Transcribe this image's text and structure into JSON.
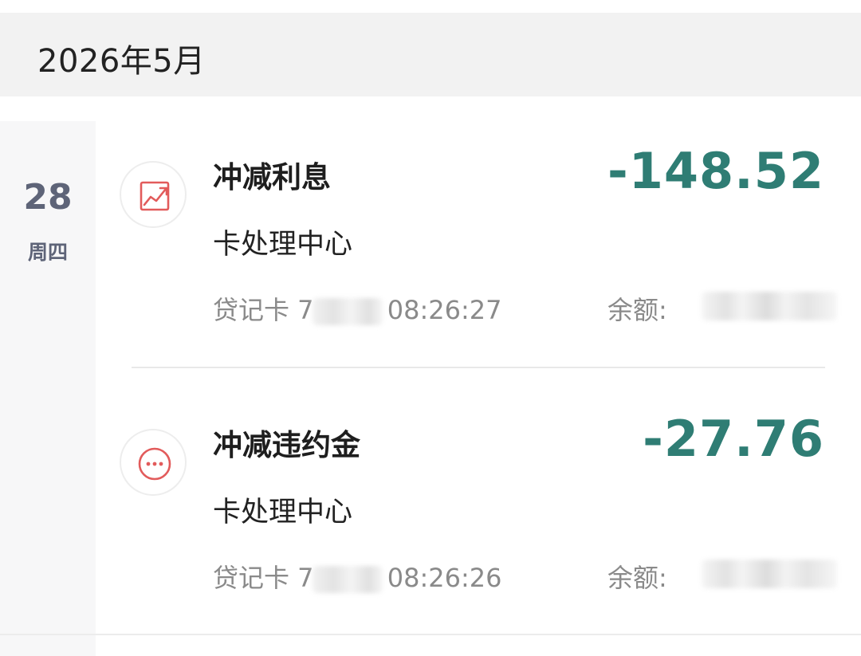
{
  "month_header": {
    "label": "2026年5月"
  },
  "day": {
    "number": "28",
    "weekday": "周四"
  },
  "transactions": [
    {
      "title": "冲减利息",
      "amount": "-148.52",
      "merchant": "卡处理中心",
      "card_prefix": "贷记卡 7",
      "time": "08:26:27",
      "balance_label": "余额:",
      "icon": "trending-up-chart-icon"
    },
    {
      "title": "冲减违约金",
      "amount": "-27.76",
      "merchant": "卡处理中心",
      "card_prefix": "贷记卡 7",
      "time": "08:26:26",
      "balance_label": "余额:",
      "icon": "more-dots-icon"
    }
  ],
  "colors": {
    "amount": "#2f7d74",
    "icon_accent": "#e25b5b",
    "day_text": "#5e6478",
    "header_bg": "#f2f2f2"
  }
}
